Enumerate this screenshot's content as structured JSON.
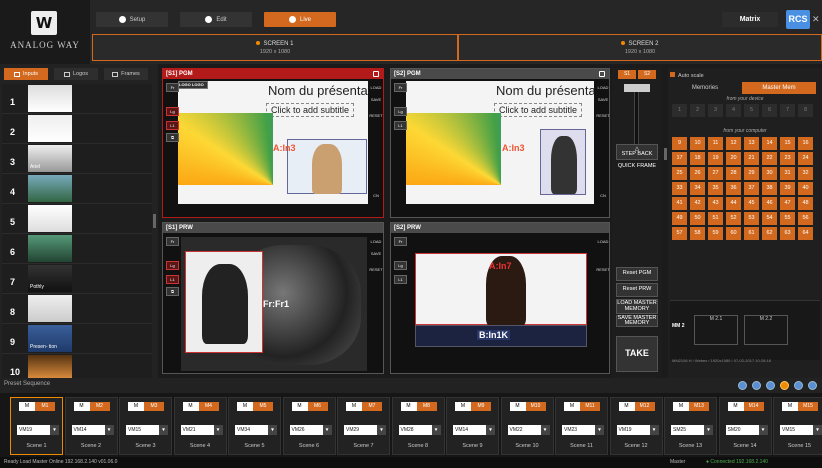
{
  "brand": {
    "mark": "W",
    "name": "ANALOG WAY"
  },
  "nav": {
    "setup": "Setup",
    "edit": "Edit",
    "live": "Live",
    "active": "Live"
  },
  "matrix_label": "Matrix",
  "rcs_label": "RCS",
  "screens": [
    {
      "name": "SCREEN 1",
      "res": "1920 x 1080"
    },
    {
      "name": "SCREEN 2",
      "res": "1920 x 1080"
    }
  ],
  "left_tabs": [
    {
      "label": "Inputs",
      "active": true
    },
    {
      "label": "Logos",
      "active": false
    },
    {
      "label": "Frames",
      "active": false
    }
  ],
  "inputs": [
    {
      "num": "1",
      "caption": ""
    },
    {
      "num": "2",
      "caption": ""
    },
    {
      "num": "3",
      "caption": "Ariel"
    },
    {
      "num": "4",
      "caption": ""
    },
    {
      "num": "5",
      "caption": ""
    },
    {
      "num": "6",
      "caption": ""
    },
    {
      "num": "7",
      "caption": "Pothly"
    },
    {
      "num": "8",
      "caption": ""
    },
    {
      "num": "9",
      "caption": "Presen- tion"
    },
    {
      "num": "10",
      "caption": ""
    }
  ],
  "panels": {
    "s1_pgm": "[S1] PGM",
    "s2_pgm": "[S2] PGM",
    "s1_prw": "[S1] PRW",
    "s2_prw": "[S2] PRW",
    "slide_title": "Nom du présentation",
    "slide_subtitle": "Click to add subtitle",
    "layer_a": "A:In3",
    "layer_pvw": "Fr:Fr1",
    "layer_in7": "A:In7",
    "layer_b": "B:In1K",
    "logo_labels": [
      "LOGO",
      "LOGO"
    ]
  },
  "side_buttons": {
    "fr": "Fr",
    "lg": "Lg",
    "l1": "L1",
    "load": "LOAD",
    "save": "SAVE",
    "ld": "LD",
    "reset": "RESET",
    "quick": "QUICK PRESP",
    "cn": "CN"
  },
  "ctrl": {
    "s1": "S1",
    "s2": "S2",
    "step_back": "STEP BACK",
    "quick_frame": "QUICK FRAME",
    "reset_pgm": "Reset PGM",
    "reset_prw": "Reset PRW",
    "load_master": "LOAD MASTER MEMORY",
    "save_master": "SAVE MASTER MEMORY",
    "take": "TAKE"
  },
  "memory": {
    "autoscale": "Auto scale",
    "tabs": [
      "Memories",
      "Master Mem"
    ],
    "from_device": "from your device",
    "from_computer": "from your computer",
    "device_row": [
      "1",
      "2",
      "3",
      "4",
      "5",
      "6",
      "7",
      "8"
    ],
    "grid": [
      [
        "9",
        "10",
        "11",
        "12",
        "13",
        "14",
        "15",
        "16"
      ],
      [
        "17",
        "18",
        "19",
        "20",
        "21",
        "22",
        "23",
        "24"
      ],
      [
        "25",
        "26",
        "27",
        "28",
        "29",
        "30",
        "31",
        "32"
      ],
      [
        "33",
        "34",
        "35",
        "36",
        "37",
        "38",
        "39",
        "40"
      ],
      [
        "41",
        "42",
        "43",
        "44",
        "45",
        "46",
        "47",
        "48"
      ],
      [
        "49",
        "50",
        "51",
        "52",
        "53",
        "54",
        "55",
        "56"
      ],
      [
        "57",
        "58",
        "59",
        "60",
        "61",
        "62",
        "63",
        "64"
      ]
    ],
    "mm_label": "MM 2",
    "m21": "M 2.1",
    "m22": "M 2.2",
    "footer": "MM2106 H / Webex / 1920x1080 / 07-02-2017 10:28:18"
  },
  "preset_title": "Preset Sequence",
  "scenes": [
    {
      "m": "M",
      "c": "M1",
      "sel": "VM19",
      "name": "Scene 1"
    },
    {
      "m": "M",
      "c": "M2",
      "sel": "VM14",
      "name": "Scene 2"
    },
    {
      "m": "M",
      "c": "M3",
      "sel": "VM15",
      "name": "Scene 3"
    },
    {
      "m": "M",
      "c": "M4",
      "sel": "VM21",
      "name": "Scene 4"
    },
    {
      "m": "M",
      "c": "M5",
      "sel": "VM34",
      "name": "Scene 5"
    },
    {
      "m": "M",
      "c": "M6",
      "sel": "VM26",
      "name": "Scene 6"
    },
    {
      "m": "M",
      "c": "M7",
      "sel": "VM29",
      "name": "Scene 7"
    },
    {
      "m": "M",
      "c": "M8",
      "sel": "VM28",
      "name": "Scene 8"
    },
    {
      "m": "M",
      "c": "M9",
      "sel": "VM14",
      "name": "Scene 9"
    },
    {
      "m": "M",
      "c": "M10",
      "sel": "VM22",
      "name": "Scene 10"
    },
    {
      "m": "M",
      "c": "M11",
      "sel": "VM23",
      "name": "Scene 11"
    },
    {
      "m": "M",
      "c": "M12",
      "sel": "VM19",
      "name": "Scene 12"
    },
    {
      "m": "M",
      "c": "M13",
      "sel": "SM25",
      "name": "Scene 13"
    },
    {
      "m": "M",
      "c": "M14",
      "sel": "SM20",
      "name": "Scene 14"
    },
    {
      "m": "M",
      "c": "M15",
      "sel": "VM15",
      "name": "Scene 15"
    }
  ],
  "status": {
    "left": "Ready   Load Master   Online   192.168.2.140  v01.06.0",
    "mid": "Master",
    "right": "● Connected 192.168.2.140"
  },
  "colors": {
    "accent": "#d2691e",
    "pgm_red": "#b31a1a",
    "blue": "#5a8fd6"
  }
}
